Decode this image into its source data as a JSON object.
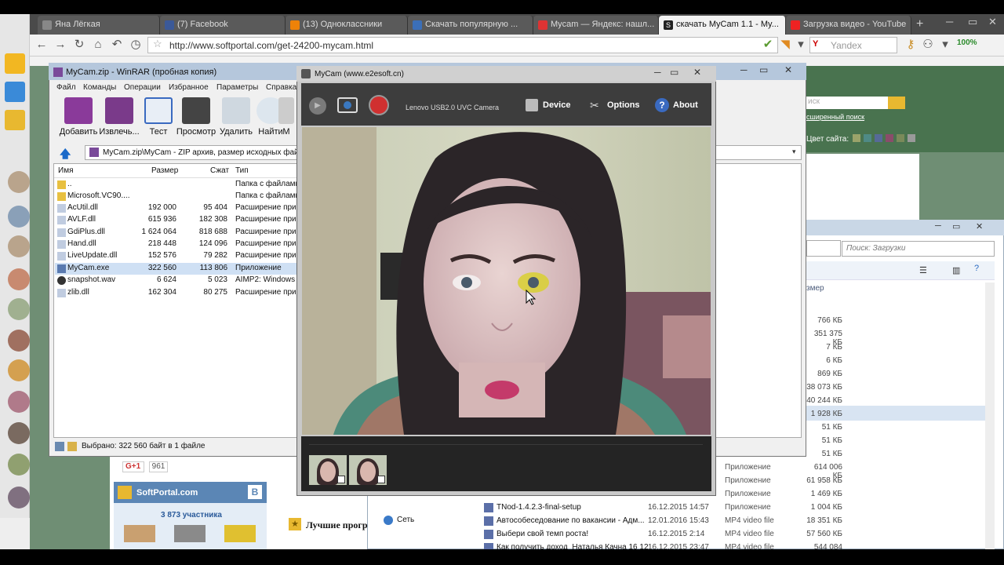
{
  "browser": {
    "tabs": [
      {
        "label": "Яна Лёгкая"
      },
      {
        "label": "(7) Facebook"
      },
      {
        "label": "(13) Одноклассники"
      },
      {
        "label": "Скачать популярную ..."
      },
      {
        "label": "Mycam — Яндекс: нашл..."
      },
      {
        "label": "скачать MyCam 1.1 - My..."
      },
      {
        "label": "Загрузка видео - YouTube"
      }
    ],
    "active_tab_icon": "S",
    "url": "http://www.softportal.com/get-24200-mycam.html",
    "search_placeholder": "Yandex",
    "search_engine_letter": "Y",
    "battery": "100%"
  },
  "site": {
    "search_placeholder": "иск",
    "advanced_search": "сширенный поиск",
    "color_label": "Цвет сайта:",
    "swatches": [
      "#9aa36a",
      "#4f8a86",
      "#566a98",
      "#8a4c6a",
      "#7a8a5a",
      "#9a9a9a"
    ],
    "gplus": "G+1",
    "gplus_count": "961",
    "widget_title": "SoftPortal.com",
    "widget_vk": "B",
    "widget_members": "3 873 участника",
    "best_title": "Лучшие прогр"
  },
  "explorer": {
    "search_placeholder": "Поиск: Загрузки",
    "size_header": "змер",
    "network": "Сеть",
    "sizes": [
      "766 КБ",
      "351 375 КБ",
      "7 КБ",
      "6 КБ",
      "869 КБ",
      "38 073 КБ",
      "40 244 КБ",
      "1 928 КБ",
      "51 КБ",
      "51 КБ",
      "51 КБ",
      "614 006 КБ",
      "61 958 КБ",
      "1 469 КБ",
      "1 004 КБ",
      "18 351 КБ",
      "57 560 КБ",
      "544 084 КБ"
    ],
    "rows": [
      {
        "name": "",
        "date": "",
        "type": "Приложение"
      },
      {
        "name": "",
        "date": "",
        "type": "Приложение"
      },
      {
        "name": "",
        "date": "",
        "type": "Приложение"
      },
      {
        "name": "TNod-1.4.2.3-final-setup",
        "date": "16.12.2015 14:57",
        "type": "Приложение"
      },
      {
        "name": "Автособеседование по вакансии - Адм...",
        "date": "12.01.2016 15:43",
        "type": "MP4 video file"
      },
      {
        "name": "Выбери свой темп роста!",
        "date": "16.12.2015 2:14",
        "type": "MP4 video file"
      },
      {
        "name": "Как получить доход_Наталья Качна 16 12",
        "date": "16.12.2015 23:47",
        "type": "MP4 video file"
      }
    ]
  },
  "winrar": {
    "title": "MyCam.zip - WinRAR (пробная копия)",
    "menu": [
      "Файл",
      "Команды",
      "Операции",
      "Избранное",
      "Параметры",
      "Справка"
    ],
    "tools": [
      "Добавить",
      "Извлечь...",
      "Тест",
      "Просмотр",
      "Удалить",
      "Найти",
      "М"
    ],
    "path": "MyCam.zip\\MyCam - ZIP архив, размер исходных файлов",
    "columns": {
      "name": "Имя",
      "size": "Размер",
      "packed": "Сжат",
      "type": "Тип"
    },
    "files": [
      {
        "name": "..",
        "size": "",
        "packed": "",
        "type": "Папка с файлами"
      },
      {
        "name": "Microsoft.VC90....",
        "size": "",
        "packed": "",
        "type": "Папка с файлами"
      },
      {
        "name": "AcUtil.dll",
        "size": "192 000",
        "packed": "95 404",
        "type": "Расширение при..."
      },
      {
        "name": "AVLF.dll",
        "size": "615 936",
        "packed": "182 308",
        "type": "Расширение при..."
      },
      {
        "name": "GdiPlus.dll",
        "size": "1 624 064",
        "packed": "818 688",
        "type": "Расширение при..."
      },
      {
        "name": "Hand.dll",
        "size": "218 448",
        "packed": "124 096",
        "type": "Расширение при..."
      },
      {
        "name": "LiveUpdate.dll",
        "size": "152 576",
        "packed": "79 282",
        "type": "Расширение при..."
      },
      {
        "name": "MyCam.exe",
        "size": "322 560",
        "packed": "113 806",
        "type": "Приложение"
      },
      {
        "name": "snapshot.wav",
        "size": "6 624",
        "packed": "5 023",
        "type": "AIMP2: Windows ..."
      },
      {
        "name": "zlib.dll",
        "size": "162 304",
        "packed": "80 275",
        "type": "Расширение при..."
      }
    ],
    "status": "Выбрано: 322 560 байт в 1 файле"
  },
  "mycam": {
    "title": "MyCam (www.e2esoft.cn)",
    "camera": "Lenovo USB2.0 UVC Camera",
    "device": "Device",
    "options": "Options",
    "about": "About"
  }
}
